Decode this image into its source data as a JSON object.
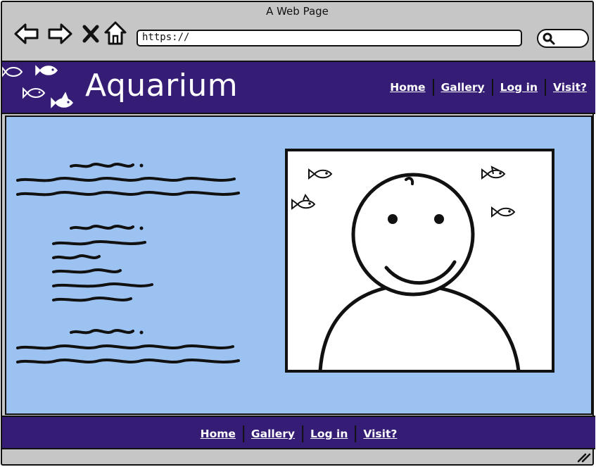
{
  "browser": {
    "title": "A Web Page",
    "url": "https://",
    "icons": [
      "back-arrow-icon",
      "forward-arrow-icon",
      "close-x-icon",
      "home-icon",
      "search-icon",
      "resize-grip-icon"
    ]
  },
  "site": {
    "title": "Aquarium",
    "nav": [
      {
        "label": "Home"
      },
      {
        "label": "Gallery"
      },
      {
        "label": "Log in"
      },
      {
        "label": "Visit?"
      }
    ]
  },
  "footer": {
    "nav": [
      {
        "label": "Home"
      },
      {
        "label": "Gallery"
      },
      {
        "label": "Log in"
      },
      {
        "label": "Visit?"
      }
    ]
  },
  "colors": {
    "header_bg": "#351c75",
    "content_bg": "#9cc2f2",
    "chrome_bg": "#c6c6c6"
  }
}
